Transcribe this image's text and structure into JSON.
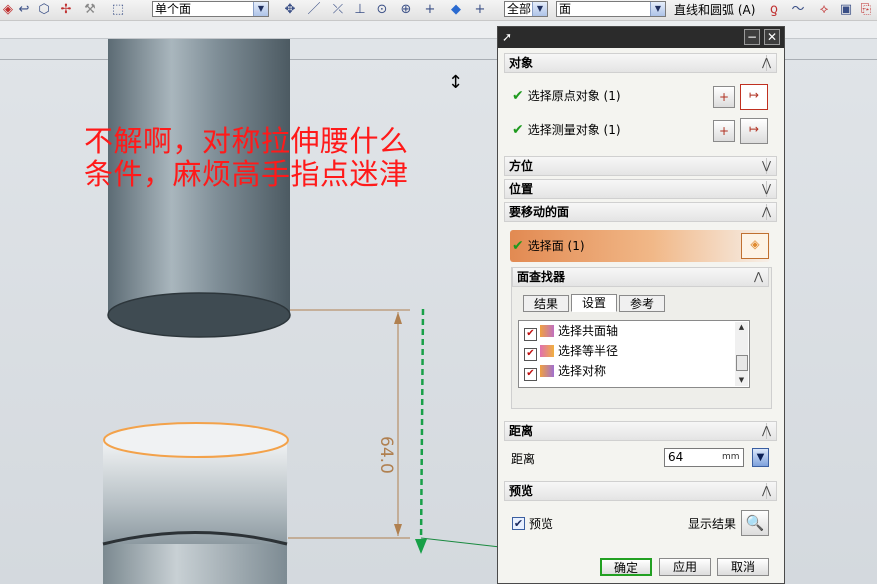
{
  "toolbar": {
    "filter_single_face": "单个面",
    "filter_all": "全部",
    "filter_face": "面",
    "curve_mode": "直线和圆弧 (A)"
  },
  "viewport": {
    "caption_line1": "不解啊，对称拉伸腰什么",
    "caption_line2": "条件，麻烦高手指点迷津",
    "dimension_value": "64.0"
  },
  "dialog": {
    "sections": {
      "object": "对象",
      "orientation": "方位",
      "position": "位置",
      "faces_to_move": "要移动的面",
      "face_finder": "面查找器",
      "distance": "距离",
      "preview": "预览"
    },
    "object_rows": {
      "origin": "选择原点对象 (1)",
      "measure": "选择测量对象 (1)"
    },
    "select_face": "选择面 (1)",
    "finder_tabs": [
      "结果",
      "设置",
      "参考"
    ],
    "finder_items": [
      {
        "label": "选择共面轴",
        "checked": true
      },
      {
        "label": "选择等半径",
        "checked": true
      },
      {
        "label": "选择对称",
        "checked": true
      }
    ],
    "distance_label": "距离",
    "distance_value": "64",
    "distance_unit": "mm",
    "preview_label": "预览",
    "preview_checked": true,
    "show_result": "显示结果",
    "buttons": {
      "ok": "确定",
      "apply": "应用",
      "cancel": "取消"
    }
  },
  "colors": {
    "caption": "#ff1a1a",
    "dimension": "#b08050",
    "highlight": "#e28a52",
    "check": "#1e9a1e"
  }
}
